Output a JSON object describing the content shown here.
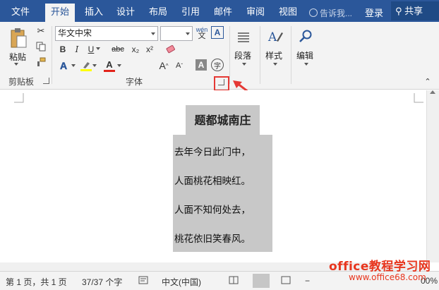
{
  "tabs": [
    "文件",
    "开始",
    "插入",
    "设计",
    "布局",
    "引用",
    "邮件",
    "审阅",
    "视图"
  ],
  "tellme": "告诉我...",
  "login": "登录",
  "share": "共享",
  "ribbon": {
    "clipboard": {
      "paste_label": "粘贴",
      "group_label": "剪贴板"
    },
    "font": {
      "font_name": "华文中宋",
      "font_size": "",
      "wen_label": "wén",
      "bold": "B",
      "italic": "I",
      "underline": "U",
      "strike": "abc",
      "sub": "x₂",
      "sup": "x²",
      "font_color_label": "A",
      "grow": "A",
      "shrink": "A",
      "clear": "A",
      "char_shading": "A",
      "enclose": "字",
      "group_label": "字体"
    },
    "paragraph": {
      "label": "段落"
    },
    "styles": {
      "label": "样式"
    },
    "editing": {
      "label": "编辑"
    }
  },
  "document": {
    "title": "题都城南庄",
    "lines": [
      "去年今日此门中，",
      "人面桃花相映红。",
      "人面不知何处去，",
      "桃花依旧笑春风。"
    ]
  },
  "status": {
    "page": "第 1 页，共 1 页",
    "words": "37/37 个字",
    "lang": "中文(中国)",
    "zoom": "00%"
  },
  "watermark": {
    "line1": "office教程学习网",
    "line2": "www.office68.com"
  },
  "colors": {
    "accent": "#2b579a",
    "highlight": "#c8c8c8",
    "annotation_red": "#e53935",
    "watermark": "#e8361e"
  }
}
